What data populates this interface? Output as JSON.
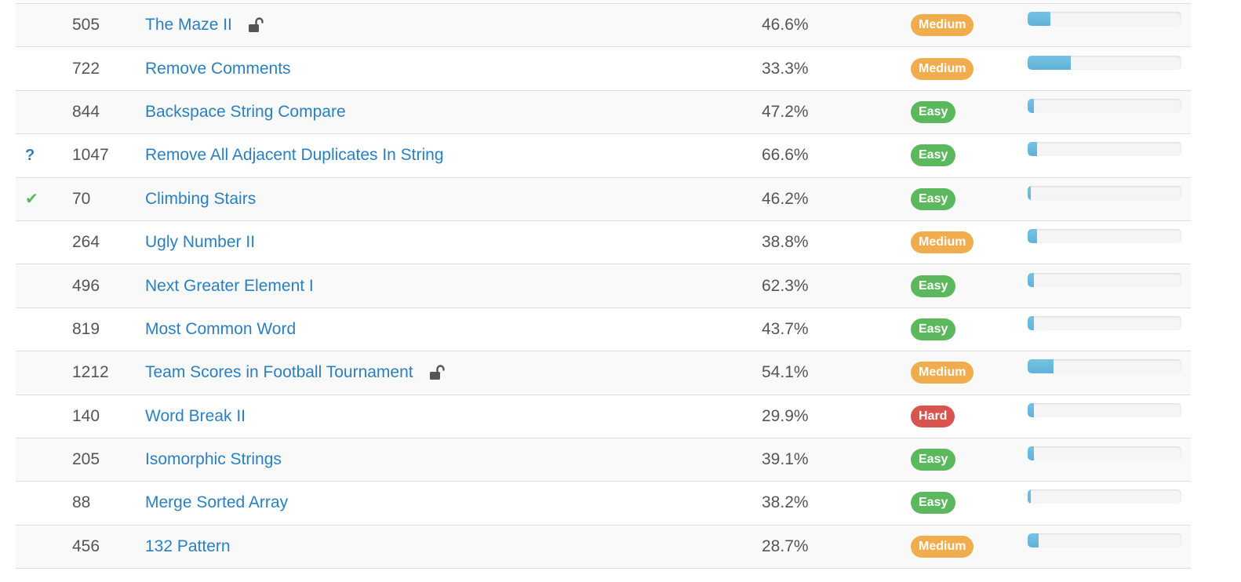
{
  "colors": {
    "link": "#2a7fc1",
    "easy": "#5cb85c",
    "medium": "#f0ad4e",
    "hard": "#d9534f",
    "frequency_bar": "#5bc0de",
    "solved_check": "#5cb85c",
    "attempted_mark": "#337ab7"
  },
  "problems": [
    {
      "status": "",
      "status_icon": "",
      "id": "505",
      "title": "The Maze II",
      "locked": true,
      "lock_icon": "unlock-icon",
      "acceptance": "46.6%",
      "difficulty": "Medium",
      "frequency": 0.15
    },
    {
      "status": "",
      "status_icon": "",
      "id": "722",
      "title": "Remove Comments",
      "locked": false,
      "acceptance": "33.3%",
      "difficulty": "Medium",
      "frequency": 0.28
    },
    {
      "status": "",
      "status_icon": "",
      "id": "844",
      "title": "Backspace String Compare",
      "locked": false,
      "acceptance": "47.2%",
      "difficulty": "Easy",
      "frequency": 0.04
    },
    {
      "status": "?",
      "status_icon": "question-mark-icon",
      "id": "1047",
      "title": "Remove All Adjacent Duplicates In String",
      "locked": false,
      "acceptance": "66.6%",
      "difficulty": "Easy",
      "frequency": 0.06
    },
    {
      "status": "✔",
      "status_icon": "check-icon",
      "id": "70",
      "title": "Climbing Stairs",
      "locked": false,
      "acceptance": "46.2%",
      "difficulty": "Easy",
      "frequency": 0.02
    },
    {
      "status": "",
      "status_icon": "",
      "id": "264",
      "title": "Ugly Number II",
      "locked": false,
      "acceptance": "38.8%",
      "difficulty": "Medium",
      "frequency": 0.06
    },
    {
      "status": "",
      "status_icon": "",
      "id": "496",
      "title": "Next Greater Element I",
      "locked": false,
      "acceptance": "62.3%",
      "difficulty": "Easy",
      "frequency": 0.04
    },
    {
      "status": "",
      "status_icon": "",
      "id": "819",
      "title": "Most Common Word",
      "locked": false,
      "acceptance": "43.7%",
      "difficulty": "Easy",
      "frequency": 0.04
    },
    {
      "status": "",
      "status_icon": "",
      "id": "1212",
      "title": "Team Scores in Football Tournament",
      "locked": true,
      "lock_icon": "unlock-icon",
      "acceptance": "54.1%",
      "difficulty": "Medium",
      "frequency": 0.17
    },
    {
      "status": "",
      "status_icon": "",
      "id": "140",
      "title": "Word Break II",
      "locked": false,
      "acceptance": "29.9%",
      "difficulty": "Hard",
      "frequency": 0.04
    },
    {
      "status": "",
      "status_icon": "",
      "id": "205",
      "title": "Isomorphic Strings",
      "locked": false,
      "acceptance": "39.1%",
      "difficulty": "Easy",
      "frequency": 0.04
    },
    {
      "status": "",
      "status_icon": "",
      "id": "88",
      "title": "Merge Sorted Array",
      "locked": false,
      "acceptance": "38.2%",
      "difficulty": "Easy",
      "frequency": 0.02
    },
    {
      "status": "",
      "status_icon": "",
      "id": "456",
      "title": "132 Pattern",
      "locked": false,
      "acceptance": "28.7%",
      "difficulty": "Medium",
      "frequency": 0.07
    }
  ]
}
